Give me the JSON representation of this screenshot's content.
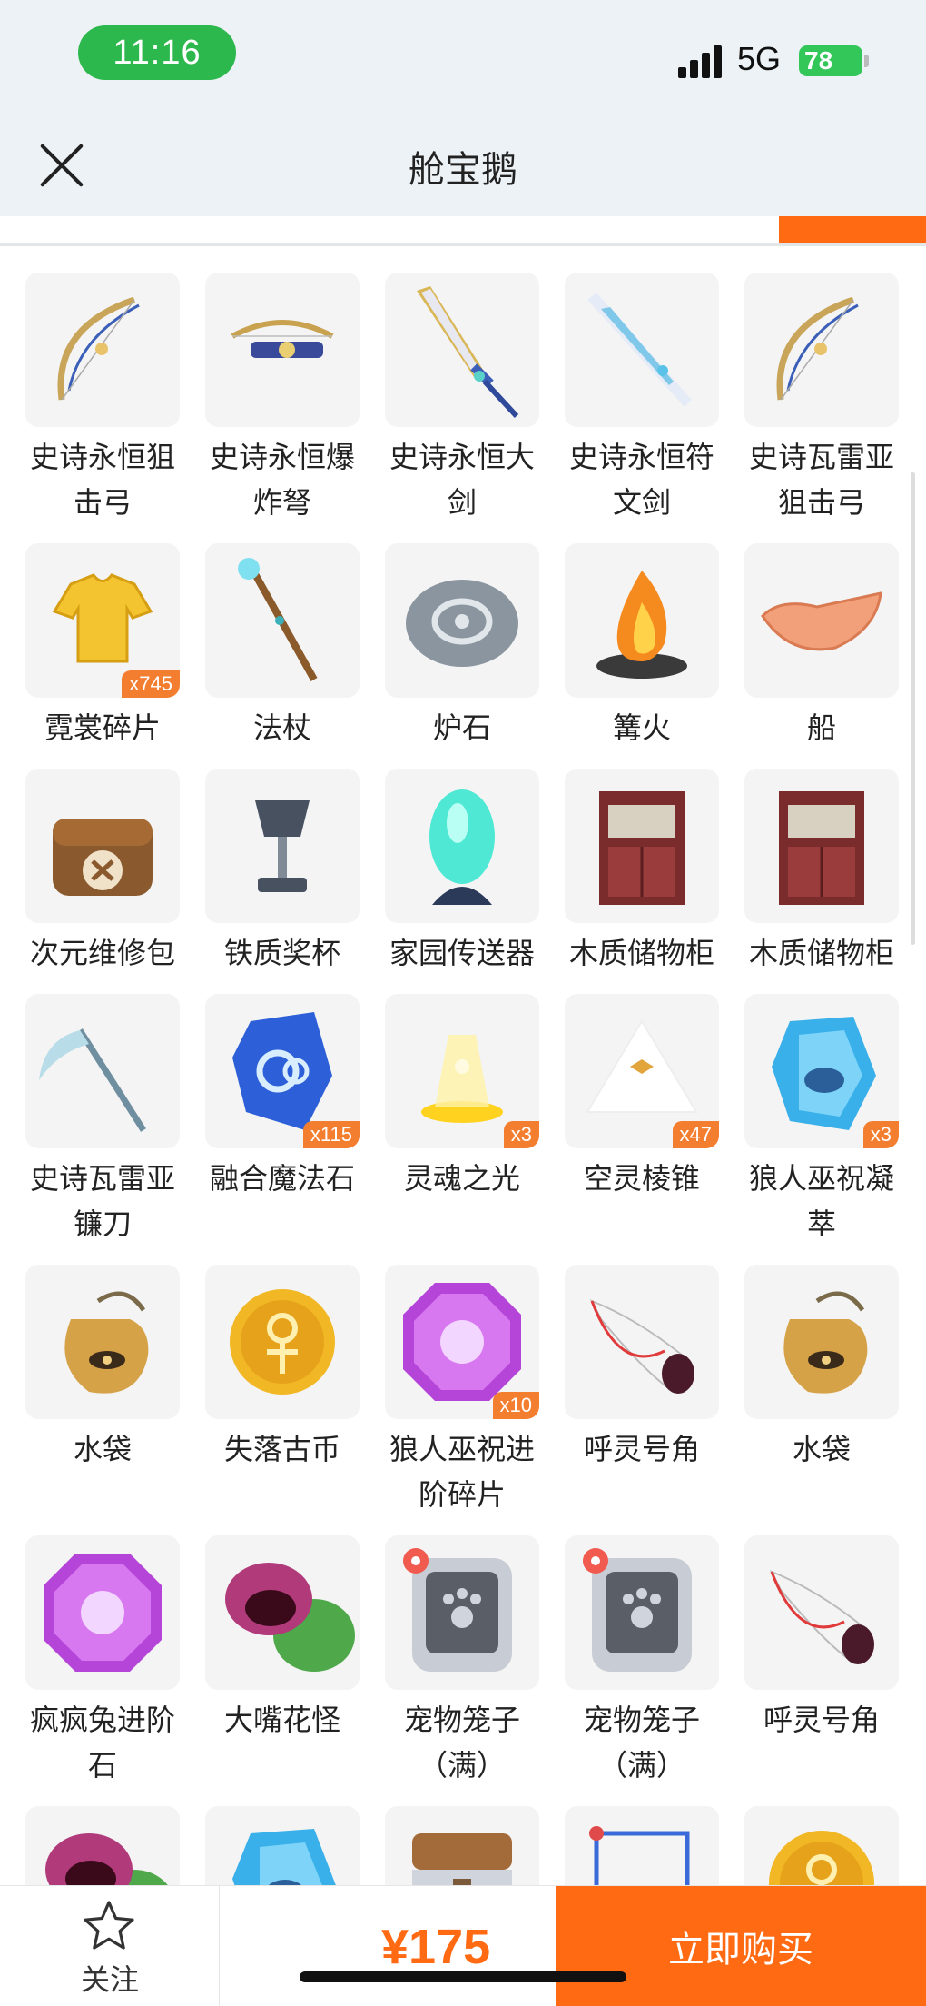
{
  "status": {
    "time": "11:16",
    "network": "5G",
    "battery": "78"
  },
  "nav": {
    "title": "舱宝鹅"
  },
  "items": [
    {
      "label": "史诗永恒狙击弓",
      "badge": "",
      "icon": "bow-icon"
    },
    {
      "label": "史诗永恒爆炸弩",
      "badge": "",
      "icon": "crossbow-icon"
    },
    {
      "label": "史诗永恒大剑",
      "badge": "",
      "icon": "greatsword-icon"
    },
    {
      "label": "史诗永恒符文剑",
      "badge": "",
      "icon": "rune-sword-icon"
    },
    {
      "label": "史诗瓦雷亚狙击弓",
      "badge": "",
      "icon": "bow-icon"
    },
    {
      "label": "霓裳碎片",
      "badge": "x745",
      "icon": "shirt-icon"
    },
    {
      "label": "法杖",
      "badge": "",
      "icon": "staff-icon"
    },
    {
      "label": "炉石",
      "badge": "",
      "icon": "hearthstone-icon"
    },
    {
      "label": "篝火",
      "badge": "",
      "icon": "campfire-icon"
    },
    {
      "label": "船",
      "badge": "",
      "icon": "boat-icon"
    },
    {
      "label": "次元维修包",
      "badge": "",
      "icon": "repair-bag-icon"
    },
    {
      "label": "铁质奖杯",
      "badge": "",
      "icon": "trophy-icon"
    },
    {
      "label": "家园传送器",
      "badge": "",
      "icon": "teleporter-icon"
    },
    {
      "label": "木质储物柜",
      "badge": "",
      "icon": "cabinet-icon"
    },
    {
      "label": "木质储物柜",
      "badge": "",
      "icon": "cabinet-icon"
    },
    {
      "label": "史诗瓦雷亚镰刀",
      "badge": "",
      "icon": "scythe-icon"
    },
    {
      "label": "融合魔法石",
      "badge": "x115",
      "icon": "magic-stone-icon"
    },
    {
      "label": "灵魂之光",
      "badge": "x3",
      "icon": "soul-light-icon"
    },
    {
      "label": "空灵棱锥",
      "badge": "x47",
      "icon": "pyramid-icon"
    },
    {
      "label": "狼人巫祝凝萃",
      "badge": "x3",
      "icon": "crystal-icon"
    },
    {
      "label": "水袋",
      "badge": "",
      "icon": "water-bag-icon"
    },
    {
      "label": "失落古币",
      "badge": "",
      "icon": "coin-icon"
    },
    {
      "label": "狼人巫祝进阶碎片",
      "badge": "x10",
      "icon": "gem-icon"
    },
    {
      "label": "呼灵号角",
      "badge": "",
      "icon": "horn-icon"
    },
    {
      "label": "水袋",
      "badge": "",
      "icon": "water-bag-icon"
    },
    {
      "label": "疯疯兔进阶石",
      "badge": "",
      "icon": "gem-icon"
    },
    {
      "label": "大嘴花怪",
      "badge": "",
      "icon": "plant-monster-icon"
    },
    {
      "label": "宠物笼子（满）",
      "badge": "",
      "icon": "pet-cage-icon"
    },
    {
      "label": "宠物笼子（满）",
      "badge": "",
      "icon": "pet-cage-icon"
    },
    {
      "label": "呼灵号角",
      "badge": "",
      "icon": "horn-icon"
    },
    {
      "label": "",
      "badge": "",
      "icon": "plant-monster-icon"
    },
    {
      "label": "",
      "badge": "",
      "icon": "crystal-icon"
    },
    {
      "label": "",
      "badge": "",
      "icon": "chest-icon"
    },
    {
      "label": "",
      "badge": "",
      "icon": "frame-icon"
    },
    {
      "label": "",
      "badge": "",
      "icon": "coin-icon"
    }
  ],
  "footer": {
    "follow_label": "关注",
    "price": "¥175",
    "buy_label": "立即购买"
  },
  "colors": {
    "accent": "#ff6a13",
    "badge": "#f47e2f",
    "status_time": "#2db84d"
  }
}
